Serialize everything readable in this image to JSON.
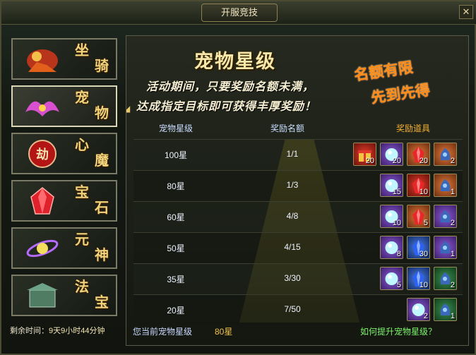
{
  "window": {
    "title": "开服竞技",
    "close_glyph": "✕"
  },
  "sidebar": {
    "items": [
      {
        "label_top": "坐",
        "label_bottom": "骑",
        "icon": "mount-icon",
        "active": false
      },
      {
        "label_top": "宠",
        "label_bottom": "物",
        "icon": "pet-icon",
        "active": true
      },
      {
        "label_top": "心",
        "label_bottom": "魔",
        "icon": "demon-icon",
        "icon_text": "劫",
        "active": false
      },
      {
        "label_top": "宝",
        "label_bottom": "石",
        "icon": "gem-icon",
        "active": false
      },
      {
        "label_top": "元",
        "label_bottom": "神",
        "icon": "spirit-icon",
        "active": false
      },
      {
        "label_top": "法",
        "label_bottom": "宝",
        "icon": "treasure-icon",
        "active": false
      }
    ]
  },
  "remaining": {
    "label": "剩余时间：",
    "value": "9天9小时44分钟"
  },
  "main": {
    "title": "宠物星级",
    "desc_line1": "活动期间，只要奖励名额未满，",
    "desc_line2": "达成指定目标即可获得丰厚奖励！",
    "promo_line1": "名额有限",
    "promo_line2": "先到先得"
  },
  "table": {
    "headers": {
      "star": "宠物星级",
      "quota": "奖励名额",
      "items": "奖励道具"
    },
    "rows": [
      {
        "star": "100星",
        "quota": "1/1",
        "items": [
          {
            "icon": "giftbox-icon",
            "bg": "red",
            "count": "20"
          },
          {
            "icon": "pearl-icon",
            "bg": "purple",
            "count": "20"
          },
          {
            "icon": "red-crystal-icon",
            "bg": "orange",
            "count": "20"
          },
          {
            "icon": "spirit-stone-icon",
            "bg": "orange",
            "count": "2"
          }
        ]
      },
      {
        "star": "80星",
        "quota": "1/3",
        "items": [
          {
            "icon": "pearl-icon",
            "bg": "purple",
            "count": "15"
          },
          {
            "icon": "red-crystal-icon",
            "bg": "red",
            "count": "10"
          },
          {
            "icon": "spirit-stone-icon",
            "bg": "orange",
            "count": "1"
          }
        ]
      },
      {
        "star": "60星",
        "quota": "4/8",
        "items": [
          {
            "icon": "pearl-icon",
            "bg": "purple",
            "count": "10"
          },
          {
            "icon": "red-crystal-icon",
            "bg": "orange",
            "count": "5"
          },
          {
            "icon": "spirit-stone-icon",
            "bg": "purple",
            "count": "2"
          }
        ]
      },
      {
        "star": "50星",
        "quota": "4/15",
        "items": [
          {
            "icon": "pearl-icon",
            "bg": "purple",
            "count": "8"
          },
          {
            "icon": "blue-crystal-icon",
            "bg": "blue",
            "count": "30"
          },
          {
            "icon": "spirit-stone-icon",
            "bg": "purple",
            "count": "1"
          }
        ]
      },
      {
        "star": "35星",
        "quota": "3/30",
        "items": [
          {
            "icon": "pearl-icon",
            "bg": "purple",
            "count": "5"
          },
          {
            "icon": "blue-crystal-icon",
            "bg": "blue",
            "count": "10"
          },
          {
            "icon": "spirit-stone-icon",
            "bg": "green",
            "count": "2"
          }
        ]
      },
      {
        "star": "20星",
        "quota": "7/50",
        "items": [
          {
            "icon": "pearl-icon",
            "bg": "purple",
            "count": "2"
          },
          {
            "icon": "spirit-stone-icon",
            "bg": "green",
            "count": "1"
          }
        ]
      }
    ]
  },
  "footer": {
    "current_label": "您当前宠物星级",
    "current_value": "80星",
    "help_link": "如何提升宠物星级？"
  },
  "colors": {
    "accent_gold": "#f0d37a",
    "promo_orange": "#ff8a14",
    "link_green": "#7cf46c"
  }
}
